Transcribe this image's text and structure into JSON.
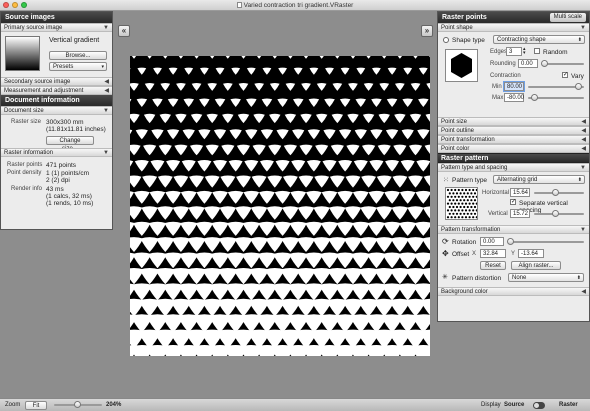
{
  "window": {
    "title": "Varied contraction tri gradient.VRaster",
    "traffic_colors": [
      "#fc605c",
      "#fdbc40",
      "#34c84a"
    ]
  },
  "left_panel": {
    "header": "Source images",
    "primary_section": "Primary source image",
    "source_name": "Vertical gradient",
    "browse_label": "Browse...",
    "presets_label": "Presets",
    "secondary_section": "Secondary source image",
    "measurement_section": "Measurement and adjustment",
    "document_header": "Document information",
    "document_size_section": "Document size",
    "raster_size_label": "Raster size",
    "raster_size_value": "300x300 mm",
    "raster_size_inches": "(11.81x11.81 inches)",
    "change_size_label": "Change size...",
    "raster_info_section": "Raster information",
    "raster_points_label": "Raster points",
    "raster_points_value": "471 points",
    "point_density_label": "Point density",
    "point_density_value1": "1 (1) points/cm",
    "point_density_value2": "2 (2) dpi",
    "render_info_label": "Render info",
    "render_info_value1": "43 ms",
    "render_info_value2": "(1 calcs, 32 ms)",
    "render_info_value3": "(1 rends, 10 ms)"
  },
  "right_panel": {
    "header": "Raster points",
    "multiscale_label": "Multi scale",
    "point_shape_section": "Point shape",
    "shape_type_label": "Shape type",
    "shape_type_value": "Contracting shape",
    "edges_label": "Edges",
    "edges_value": "3",
    "random_label": "Random",
    "rounding_label": "Rounding",
    "rounding_value": "0.00",
    "contraction_label": "Contraction",
    "vary_label": "Vary",
    "min_label": "Min",
    "min_value": "80.00",
    "max_label": "Max",
    "max_value": "-80.00",
    "point_size_section": "Point size",
    "point_outline_section": "Point outline",
    "point_transformation_section": "Point transformation",
    "point_color_section": "Point color",
    "pattern_header": "Raster pattern",
    "pattern_type_spacing_section": "Pattern type and spacing",
    "pattern_type_label": "Pattern type",
    "pattern_type_value": "Alternating grid",
    "horizontal_label": "Horizontal",
    "horizontal_value": "15.64",
    "separate_spacing_label": "Separate vertical spacing",
    "vertical_label": "Vertical",
    "vertical_value": "15.72",
    "pattern_transformation_section": "Pattern transformation",
    "rotation_label": "Rotation",
    "rotation_value": "0.00",
    "offset_label": "Offset",
    "offset_x_label": "X",
    "offset_x_value": "32.84",
    "offset_y_label": "Y",
    "offset_y_value": "-13.64",
    "reset_label": "Reset",
    "align_raster_label": "Align raster...",
    "pattern_distortion_label": "Pattern distortion",
    "pattern_distortion_value": "None",
    "background_color_section": "Background color"
  },
  "statusbar": {
    "zoom_label": "Zoom",
    "fit_label": "Fit",
    "zoom_value": "204%",
    "display_label": "Display",
    "source_label": "Source",
    "raster_label": "Raster"
  }
}
